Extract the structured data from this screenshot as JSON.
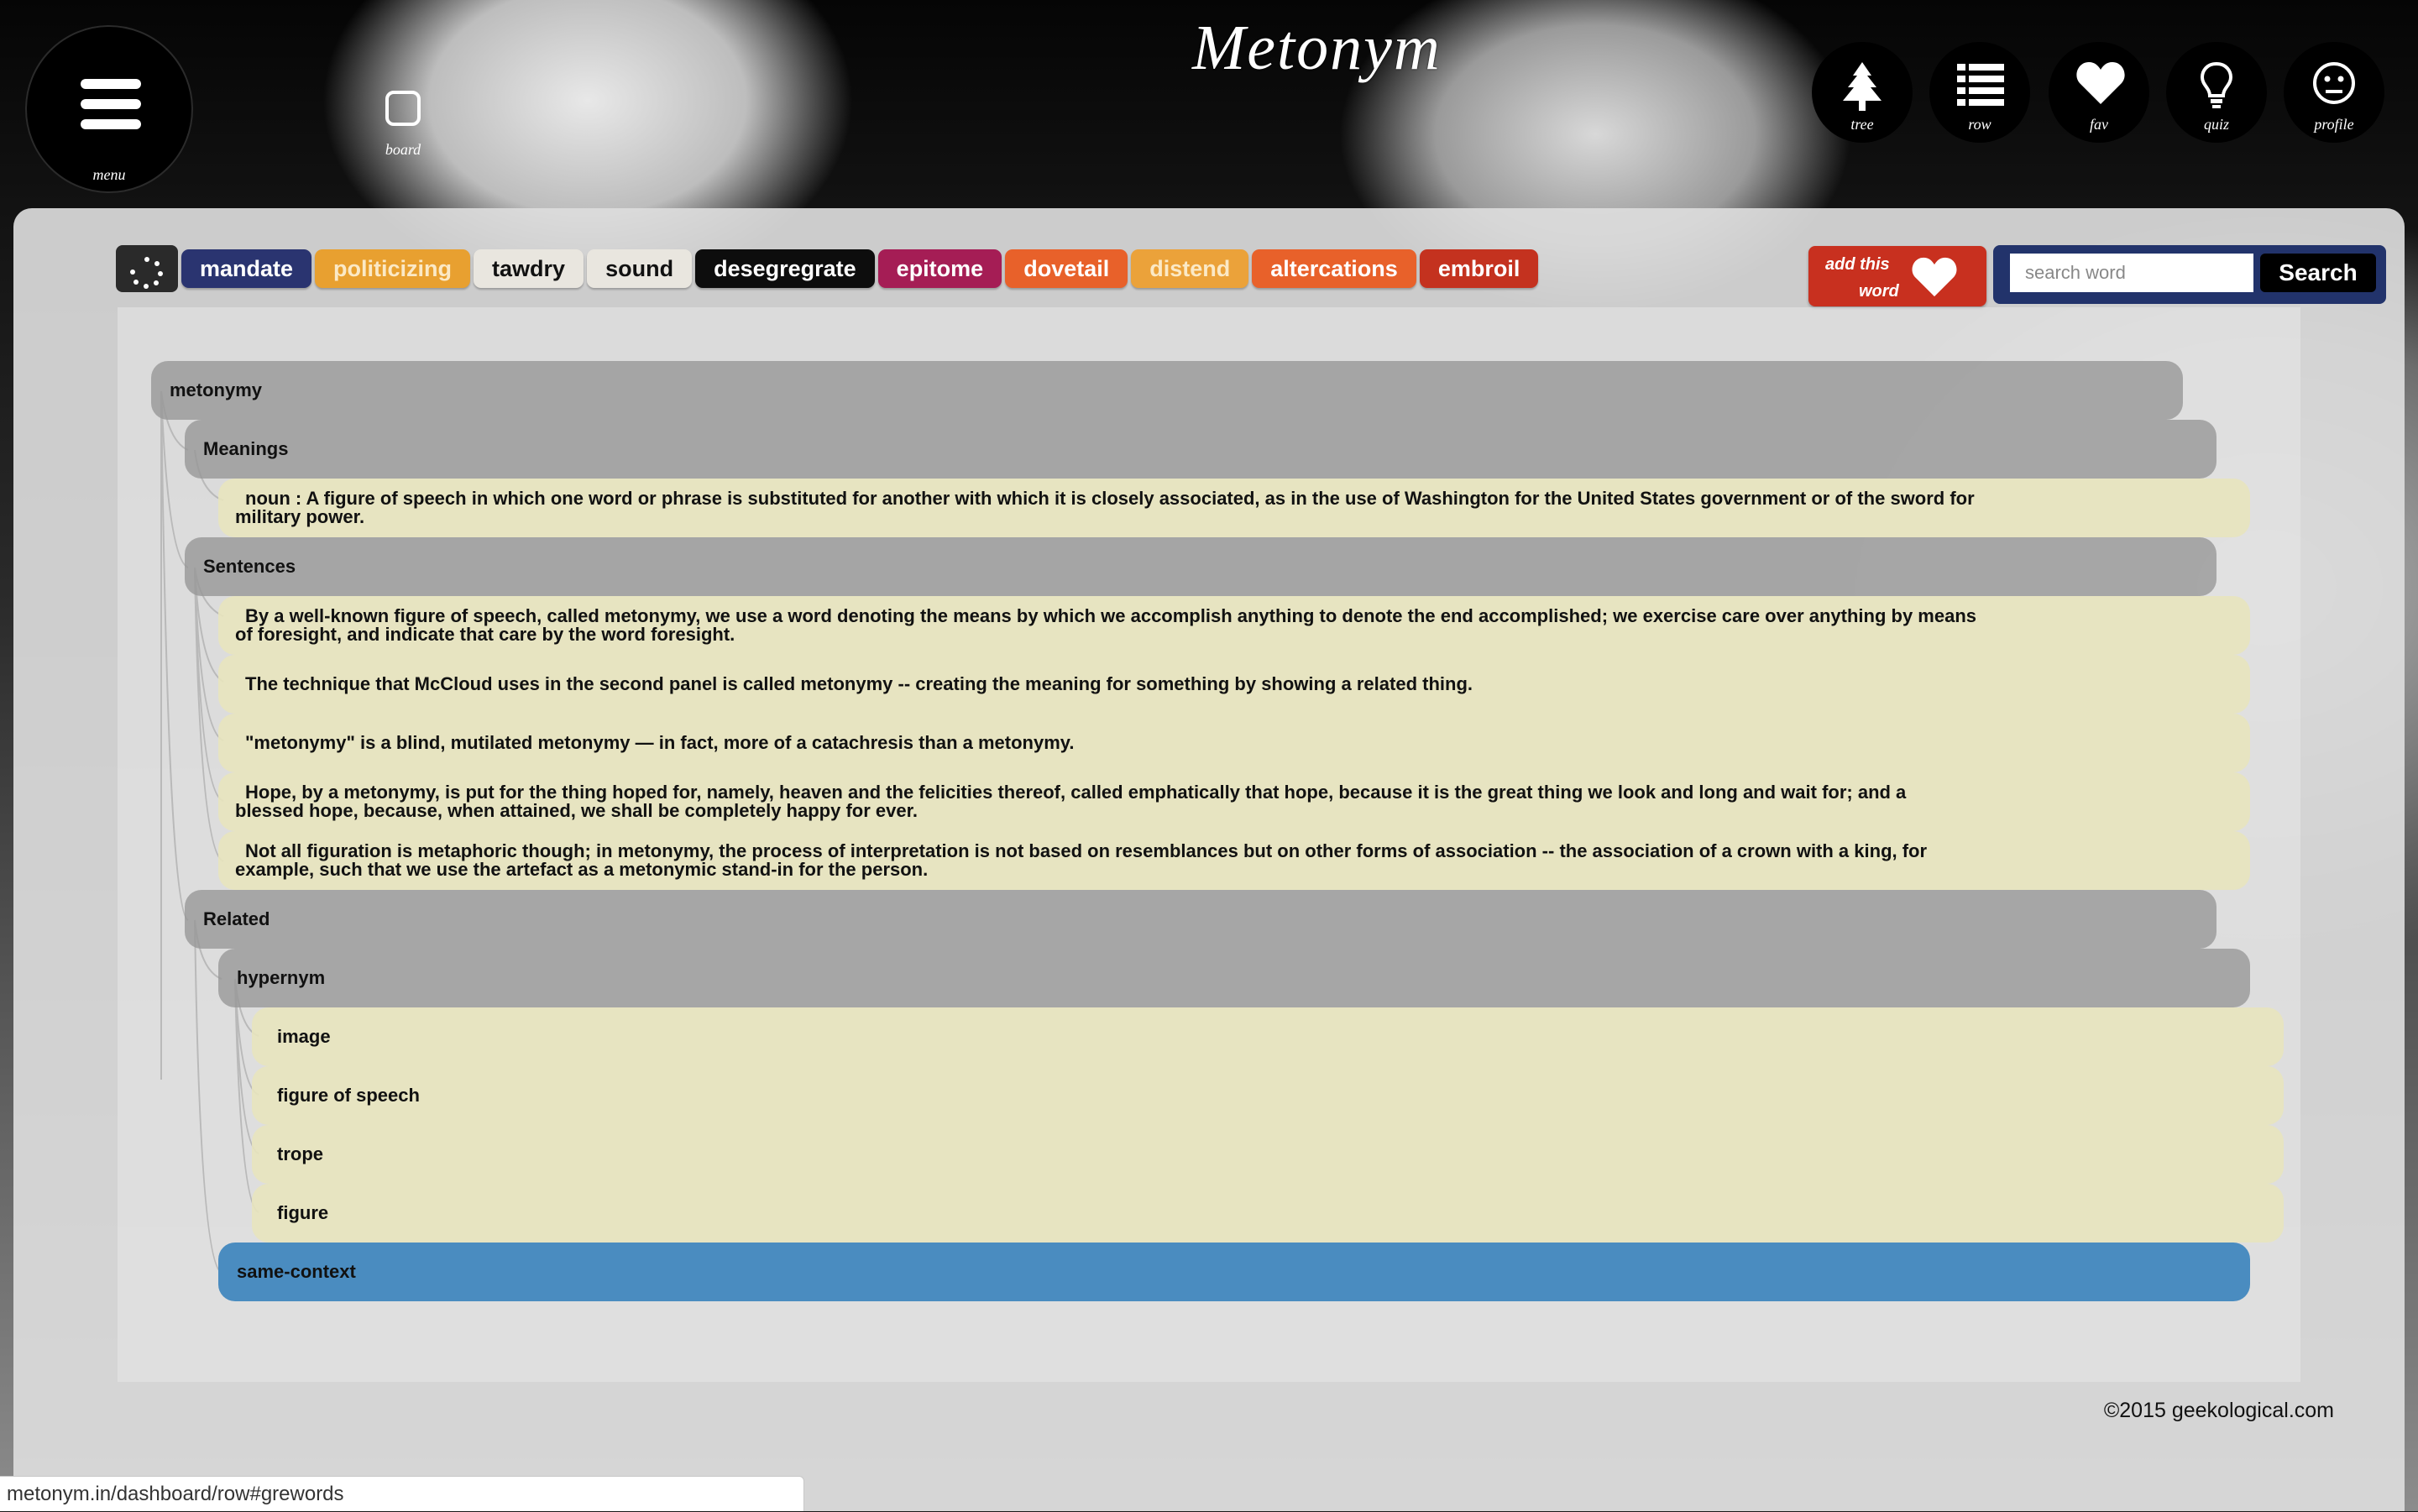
{
  "app": {
    "logo": "Metonym"
  },
  "nav": {
    "menu_label": "menu",
    "board_label": "board",
    "right": [
      {
        "label": "tree",
        "icon": "tree-icon"
      },
      {
        "label": "row",
        "icon": "list-icon"
      },
      {
        "label": "fav",
        "icon": "heart-icon"
      },
      {
        "label": "quiz",
        "icon": "lightbulb-icon"
      },
      {
        "label": "profile",
        "icon": "face-icon"
      }
    ]
  },
  "words": [
    {
      "label": "mandate",
      "bg": "#2a3470",
      "fg": "#ffffff"
    },
    {
      "label": "politicizing",
      "bg": "#e8a030",
      "fg": "#fbe9c6"
    },
    {
      "label": "tawdry",
      "bg": "#e9e6df",
      "fg": "#111111"
    },
    {
      "label": "sound",
      "bg": "#e9e6df",
      "fg": "#111111"
    },
    {
      "label": "desegregrate",
      "bg": "#0d0d0d",
      "fg": "#ffffff"
    },
    {
      "label": "epitome",
      "bg": "#a51d55",
      "fg": "#ffffff"
    },
    {
      "label": "dovetail",
      "bg": "#e8612a",
      "fg": "#ffffff"
    },
    {
      "label": "distend",
      "bg": "#eba23a",
      "fg": "#fbe9c6"
    },
    {
      "label": "altercations",
      "bg": "#e8612a",
      "fg": "#ffffff"
    },
    {
      "label": "embroil",
      "bg": "#c4321f",
      "fg": "#ffffff"
    }
  ],
  "add_word": {
    "line1": "add this",
    "line2": "word"
  },
  "search": {
    "placeholder": "search word",
    "button": "Search"
  },
  "tree": {
    "root": "metonymy",
    "meanings_label": "Meanings",
    "meaning": "noun : A figure of speech in which one word or phrase is substituted for another with which it is closely associated, as in the use of Washington for the United States government or of the sword for military power.",
    "sentences_label": "Sentences",
    "sentences": [
      "By a well-known figure of speech, called metonymy, we use a word denoting the means by which we accomplish anything to denote the end accomplished; we exercise care over anything by means of foresight, and indicate that care by the word foresight.",
      "The technique that McCloud uses in the second panel is called metonymy -- creating the meaning for something by showing a related thing.",
      "\"metonymy\" is a blind, mutilated metonymy — in fact, more of a catachresis than a metonymy.",
      "Hope, by a metonymy, is put for the thing hoped for, namely, heaven and the felicities thereof, called emphatically that hope, because it is the great thing we look and long and wait for; and a blessed hope, because, when attained, we shall be completely happy for ever.",
      "Not all figuration is metaphoric though; in metonymy, the process of interpretation is not based on resemblances but on other forms of association -- the association of a crown with a king, for example, such that we use the artefact as a metonymic stand-in for the person."
    ],
    "related_label": "Related",
    "hypernym_label": "hypernym",
    "hypernyms": [
      "image",
      "figure of speech",
      "trope",
      "figure"
    ],
    "same_context_label": "same-context"
  },
  "footer": {
    "copyright": "©2015 geekological.com"
  },
  "status_url": "metonym.in/dashboard/row#grewords",
  "colors": {
    "accent_red": "#c8301f",
    "search_navy": "#22336b",
    "highlight_blue": "#4a8cc0"
  }
}
